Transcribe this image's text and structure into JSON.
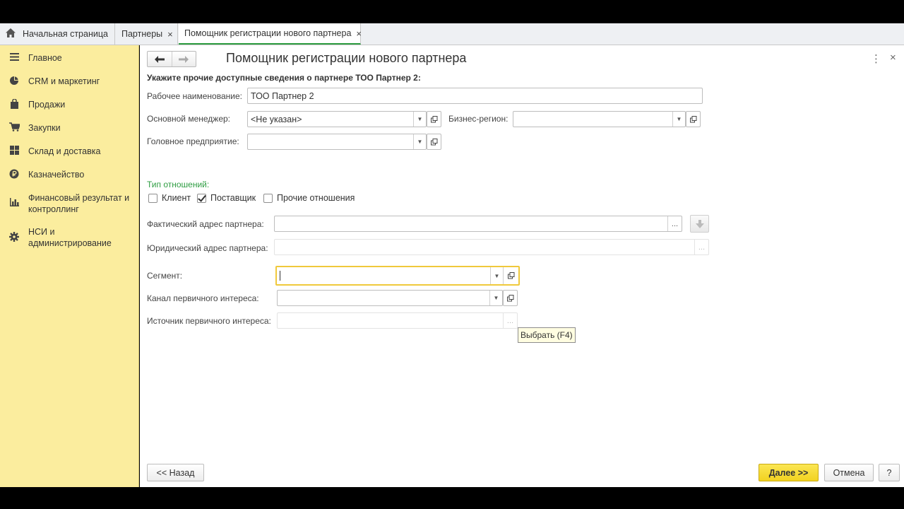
{
  "tabs": {
    "home_label": "Начальная страница",
    "partners_label": "Партнеры",
    "active_label": "Помощник регистрации нового партнера",
    "close_glyph": "×"
  },
  "sidebar": {
    "items": [
      {
        "label": "Главное",
        "icon": "menu-lines-icon"
      },
      {
        "label": "CRM и маркетинг",
        "icon": "pie-chart-icon"
      },
      {
        "label": "Продажи",
        "icon": "shopping-bag-icon"
      },
      {
        "label": "Закупки",
        "icon": "cart-icon"
      },
      {
        "label": "Склад и доставка",
        "icon": "grid-icon"
      },
      {
        "label": "Казначейство",
        "icon": "ruble-coin-icon"
      },
      {
        "label": "Финансовый результат и контроллинг",
        "icon": "bar-chart-icon"
      },
      {
        "label": "НСИ и администрирование",
        "icon": "gear-icon"
      }
    ]
  },
  "form": {
    "title": "Помощник регистрации нового партнера",
    "subtitle": "Укажите прочие доступные сведения о партнере ТОО Партнер 2:",
    "fields": {
      "work_name_label": "Рабочее наименование:",
      "work_name_value": "ТОО Партнер 2",
      "manager_label": "Основной менеджер:",
      "manager_value": "<Не указан>",
      "region_label": "Бизнес-регион:",
      "region_value": "",
      "head_label": "Головное предприятие:",
      "head_value": ""
    },
    "relations": {
      "section_label": "Тип отношений:",
      "client_label": "Клиент",
      "client_checked": false,
      "supplier_label": "Поставщик",
      "supplier_checked": true,
      "other_label": "Прочие отношения",
      "other_checked": false
    },
    "addresses": {
      "actual_label": "Фактический адрес партнера:",
      "actual_value": "",
      "legal_label": "Юридический адрес партнера:",
      "legal_value": ""
    },
    "segment_label": "Сегмент:",
    "segment_value": "",
    "channel_label": "Канал первичного интереса:",
    "channel_value": "",
    "source_label": "Источник первичного интереса:",
    "source_value": "",
    "ellipsis": "...",
    "tooltip": "Выбрать (F4)"
  },
  "footer": {
    "back_label": "<< Назад",
    "next_label": "Далее >>",
    "cancel_label": "Отмена",
    "help_label": "?"
  },
  "colors": {
    "sidebar_bg": "#fbed9e",
    "accent_green": "#2e9d42",
    "primary_button": "#f2d220",
    "focus_border": "#f0c93c"
  }
}
